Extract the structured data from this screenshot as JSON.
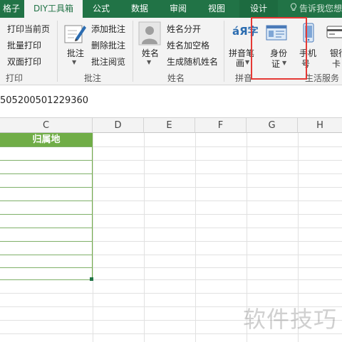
{
  "tabs": [
    {
      "label": "格子",
      "active": false
    },
    {
      "label": "DIY工具箱",
      "active": true
    },
    {
      "label": "公式",
      "active": false
    },
    {
      "label": "数据",
      "active": false
    },
    {
      "label": "审阅",
      "active": false
    },
    {
      "label": "视图",
      "active": false
    },
    {
      "label": "设计",
      "active": false
    }
  ],
  "tell_me": "告诉我您想",
  "ribbon": {
    "print_group": {
      "items": [
        "打印当前页",
        "批量打印",
        "双面打印"
      ],
      "label": "打印"
    },
    "comment_group": {
      "big_button": "批注",
      "items": [
        "添加批注",
        "删除批注",
        "批注阅览"
      ],
      "label": "批注"
    },
    "name_group": {
      "big_button": "姓名",
      "items": [
        "姓名分开",
        "姓名加空格",
        "生成随机姓名"
      ],
      "label": "姓名"
    },
    "pinyin_group": {
      "big_button_line1": "拼音笔",
      "big_button_line2": "画",
      "icon_text": "áЯ字",
      "label": "拼音"
    },
    "life_group": {
      "id_card_line1": "身份",
      "id_card_line2": "证",
      "phone_line1": "手机",
      "phone_line2": "号",
      "bank_line1": "银行",
      "bank_line2": "卡",
      "label": "生活服务"
    }
  },
  "formula_bar": {
    "value": "505200501229360"
  },
  "grid": {
    "columns": [
      "C",
      "D",
      "E",
      "F",
      "G",
      "H"
    ],
    "header_cell": "归属地"
  },
  "watermark": "软件技巧",
  "colors": {
    "accent": "#217346",
    "table_header": "#70ad47",
    "highlight": "#e53935"
  }
}
